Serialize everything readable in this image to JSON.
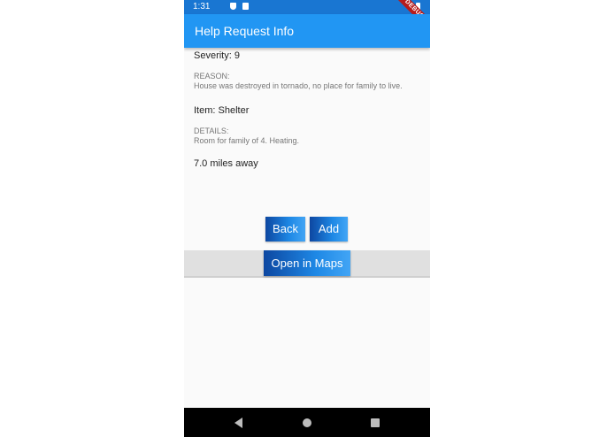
{
  "status_bar": {
    "time": "1:31",
    "debug_banner": "DEBUG"
  },
  "app_bar": {
    "title": "Help Request Info"
  },
  "request": {
    "severity": "Severity: 9",
    "reason_label": "REASON:",
    "reason_text": "House was destroyed in tornado, no place for family to live.",
    "item": "Item: Shelter",
    "details_label": "DETAILS:",
    "details_text": "Room for family of 4. Heating.",
    "distance": "7.0 miles away"
  },
  "buttons": {
    "back": "Back",
    "add": "Add",
    "open_maps": "Open in Maps"
  },
  "nav_bar": {
    "back_icon": "triangle-back-icon",
    "home_icon": "circle-home-icon",
    "recent_icon": "square-recents-icon"
  },
  "colors": {
    "app_bar": "#2196f3",
    "status_bar": "#1976d2",
    "button_gradient_start": "#0d47a1",
    "button_gradient_end": "#42a5f5",
    "maps_bar": "#e0e0e0"
  }
}
